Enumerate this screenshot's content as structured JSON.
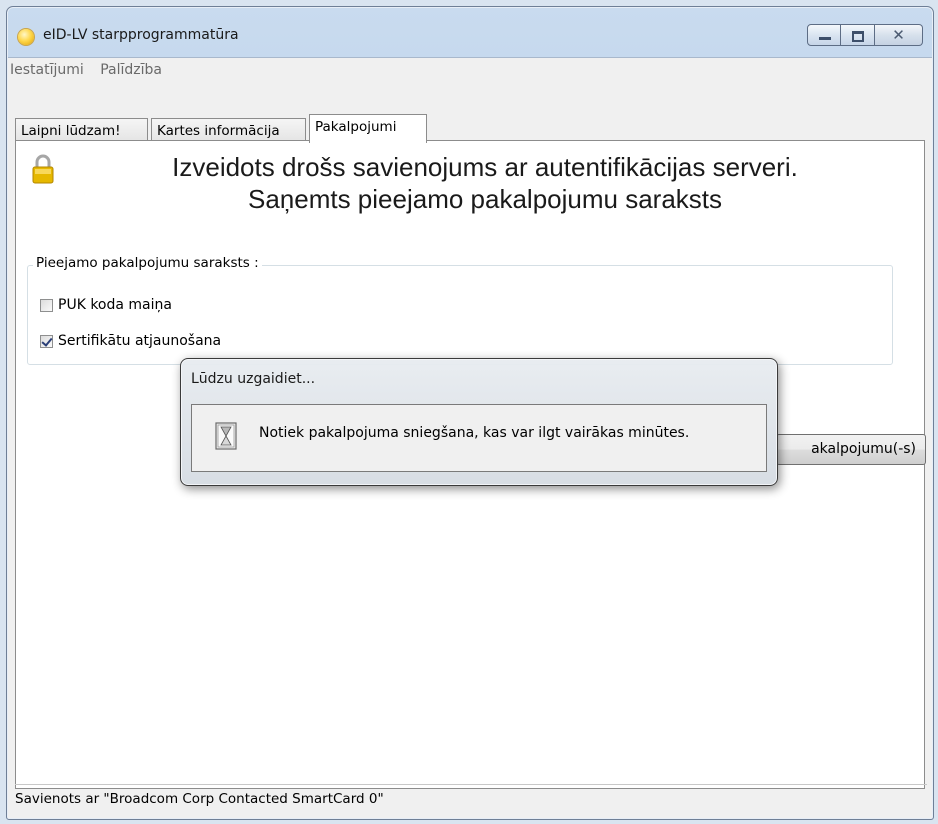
{
  "window": {
    "title": "eID-LV starpprogrammatūra",
    "icon": "app-icon"
  },
  "menu": {
    "items": [
      "Iestatījumi",
      "Palīdzība"
    ]
  },
  "tabs": [
    {
      "label": "Laipni lūdzam!",
      "active": false
    },
    {
      "label": "Kartes informācija",
      "active": false
    },
    {
      "label": "Pakalpojumi",
      "active": true
    }
  ],
  "services": {
    "headline_line1": "Izveidots drošs savienojums ar autentifikācijas serveri.",
    "headline_line2": "Saņemts pieejamo pakalpojumu saraksts",
    "group_label": "Pieejamo pakalpojumu saraksts :",
    "options": [
      {
        "label": "PUK koda maiņa",
        "checked": false
      },
      {
        "label": "Sertifikātu atjaunošana",
        "checked": true
      }
    ],
    "action_button_visible_text": "akalpojumu(-s)"
  },
  "status_bar": {
    "text": "Savienots ar \"Broadcom Corp Contacted SmartCard 0\""
  },
  "modal": {
    "title": "Lūdzu uzgaidiet...",
    "message": "Notiek pakalpojuma sniegšana, kas var ilgt vairākas minūtes.",
    "icon": "hourglass-icon"
  },
  "colors": {
    "window_frame": "#b7cde6",
    "panel_bg": "#ffffff",
    "checkmark": "#2b3f77",
    "lock_body": "#e6b800"
  }
}
